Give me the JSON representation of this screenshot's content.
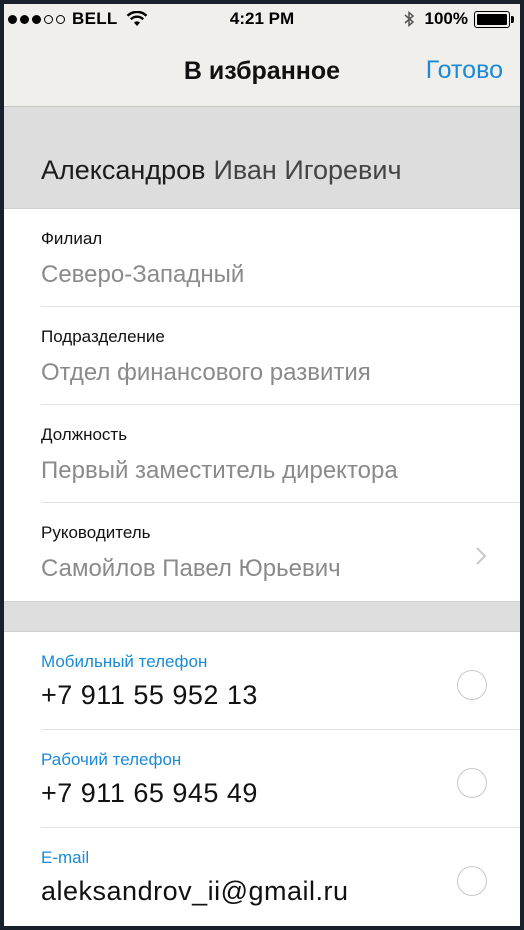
{
  "status_bar": {
    "carrier": "BELL",
    "time": "4:21 PM",
    "battery": "100%",
    "signal_bars_filled": 3,
    "signal_bars_total": 5
  },
  "navbar": {
    "title": "В избранное",
    "done_label": "Готово"
  },
  "person": {
    "last_name": "Александров",
    "first_middle": "Иван Игоревич"
  },
  "details": [
    {
      "label": "Филиал",
      "value": "Северо-Западный"
    },
    {
      "label": "Подразделение",
      "value": "Отдел финансового развития"
    },
    {
      "label": "Должность",
      "value": "Первый заместитель директора"
    },
    {
      "label": "Руководитель",
      "value": "Самойлов Павел Юрьевич"
    }
  ],
  "contacts": [
    {
      "label": "Мобильный телефон",
      "value": "+7 911 55 952 13"
    },
    {
      "label": "Рабочий телефон",
      "value": "+7 911 65 945 49"
    },
    {
      "label": "E-mail",
      "value": "aleksandrov_ii@gmail.ru"
    }
  ],
  "colors": {
    "accent": "#1a8ad8",
    "background": "#f1efec",
    "section_header": "#dddddd",
    "frame": "#17202b"
  }
}
